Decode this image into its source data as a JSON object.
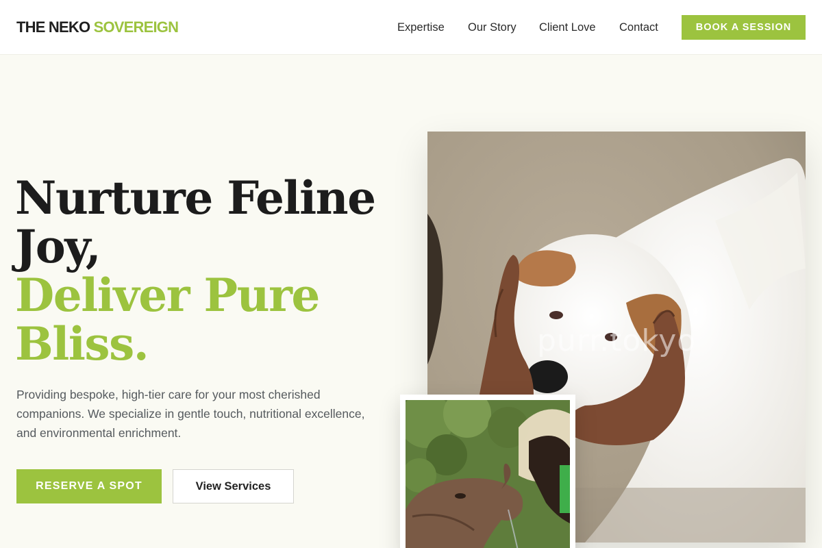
{
  "brand": {
    "name_primary": "THE NEKO",
    "name_accent": "SOVEREIGN",
    "accent_color": "#9cc33f"
  },
  "nav": {
    "items": [
      {
        "label": "Expertise"
      },
      {
        "label": "Our Story"
      },
      {
        "label": "Client Love"
      },
      {
        "label": "Contact"
      }
    ],
    "cta_label": "BOOK A SESSION"
  },
  "hero": {
    "headline_line1": "Nurture Feline",
    "headline_line2": "Joy,",
    "headline_line3": "Deliver Pure",
    "headline_line4": "Bliss.",
    "description": "Providing bespoke, high-tier care for your most cherished companions. We specialize in gentle touch, nutritional excellence, and environmental enrichment.",
    "primary_button": "RESERVE A SPOT",
    "secondary_button": "View Services"
  },
  "images": {
    "main_watermark": "purr.tokyo"
  }
}
